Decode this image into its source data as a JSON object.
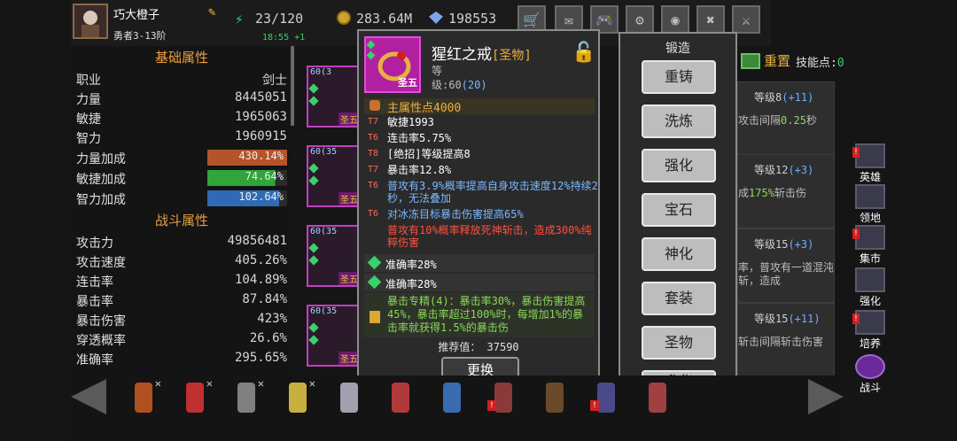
{
  "player": {
    "name": "巧大橙子",
    "rank": "勇者3-13阶",
    "energy": "23/120",
    "energy_timer": "18:55 +1",
    "gold": "283.64M",
    "gems": "198553"
  },
  "top_buttons": [
    "shop-cart-icon",
    "mail-icon",
    "gamepad-icon",
    "gear-icon",
    "palette-icon",
    "locked-icon",
    "swords-icon"
  ],
  "stats": {
    "basic_title": "基础属性",
    "battle_title": "战斗属性",
    "basic": [
      {
        "label": "职业",
        "value": "剑士"
      },
      {
        "label": "力量",
        "value": "8445051"
      },
      {
        "label": "敏捷",
        "value": "1965063"
      },
      {
        "label": "智力",
        "value": "1960915"
      }
    ],
    "bonuses": [
      {
        "label": "力量加成",
        "value": "430.14%",
        "color": "#b5542a",
        "fill": 1.0
      },
      {
        "label": "敏捷加成",
        "value": "74.64%",
        "color": "#2fa53a",
        "fill": 0.85
      },
      {
        "label": "智力加成",
        "value": "102.64%",
        "color": "#2f6ab5",
        "fill": 0.9
      }
    ],
    "battle": [
      {
        "label": "攻击力",
        "value": "49856481"
      },
      {
        "label": "攻击速度",
        "value": "405.26%"
      },
      {
        "label": "连击率",
        "value": "104.89%"
      },
      {
        "label": "暴击率",
        "value": "87.84%"
      },
      {
        "label": "暴击伤害",
        "value": "423%"
      },
      {
        "label": "穿透概率",
        "value": "26.6%"
      },
      {
        "label": "准确率",
        "value": "295.65%"
      }
    ]
  },
  "equipment_slots": [
    {
      "level": "60(3",
      "tag": "圣五"
    },
    {
      "level": "60(35",
      "tag": "圣五"
    },
    {
      "level": "60(35",
      "tag": "圣五"
    },
    {
      "level": "60(35",
      "tag": "圣五"
    }
  ],
  "item": {
    "name": "猩红之戒",
    "rarity": "[圣物]",
    "tier": "圣五",
    "level_label": "等",
    "level_prefix": "级:60",
    "level_bonus": "(20)",
    "main_attr": "主属性点4000",
    "affixes": [
      {
        "tier": "T7",
        "text": "敏捷1993",
        "color": "#ffffff"
      },
      {
        "tier": "T6",
        "text": "连击率5.75%",
        "color": "#ffffff"
      },
      {
        "tier": "T8",
        "text": "[绝招]等级提高8",
        "color": "#ffffff"
      },
      {
        "tier": "T7",
        "text": "暴击率12.8%",
        "color": "#ffffff"
      },
      {
        "tier": "T6",
        "text": "普攻有3.9%概率提高自身攻击速度12%持续2秒，无法叠加",
        "color": "#7ab8ff"
      },
      {
        "tier": "T6",
        "text": "对冰冻目标暴击伤害提高65%",
        "color": "#7ab8ff"
      },
      {
        "tier": "",
        "text": "普攻有10%概率释放死神斩击，造成300%纯粹伤害",
        "color": "#ff5040"
      }
    ],
    "gems": [
      "准确率28%",
      "准确率28%"
    ],
    "set_bonus": "暴击专精(4)：暴击率30%，暴击伤害提高45%，暴击率超过100%时，每增加1%的暴击率就获得1.5%的暴击伤",
    "recommend": "推荐值： 37590",
    "replace_label": "更换"
  },
  "forge": {
    "title": "锻造",
    "buttons": [
      "重铸",
      "洗炼",
      "强化",
      "宝石",
      "神化",
      "套装",
      "圣物",
      "升华"
    ]
  },
  "skills": {
    "reset_label": "重置",
    "points_label": "技能点:",
    "points_value": "0",
    "cards": [
      {
        "level": "等级8",
        "bonus": "(+11)",
        "desc_a": "攻击间隔",
        "desc_hl": "0.25",
        "desc_b": "秒"
      },
      {
        "level": "等级12",
        "bonus": "(+3)",
        "desc_a": "成",
        "desc_hl": "175%",
        "desc_b": "斩击伤"
      },
      {
        "level": "等级15",
        "bonus": "(+3)",
        "desc_a": "率，普攻有一道混沌斩，造成",
        "desc_hl": "",
        "desc_b": ""
      },
      {
        "level": "等级15",
        "bonus": "(+11)",
        "desc_a": "斩击间隔斩击伤害",
        "desc_hl": "",
        "desc_b": ""
      }
    ]
  },
  "nav": [
    {
      "label": "英雄",
      "icon": "hero-icon",
      "alert": true
    },
    {
      "label": "领地",
      "icon": "territory-icon",
      "alert": false
    },
    {
      "label": "集市",
      "icon": "market-icon",
      "alert": true
    },
    {
      "label": "强化",
      "icon": "enhance-icon",
      "alert": false
    },
    {
      "label": "培养",
      "icon": "train-icon",
      "alert": true
    },
    {
      "label": "战斗",
      "icon": "battle-icon",
      "alert": false
    }
  ],
  "heroes": [
    {
      "color": "#b05020",
      "crossed": true,
      "alert": false
    },
    {
      "color": "#c03030",
      "crossed": true,
      "alert": false
    },
    {
      "color": "#808080",
      "crossed": true,
      "alert": false
    },
    {
      "color": "#c8b040",
      "crossed": true,
      "alert": false
    },
    {
      "color": "#a0a0b0",
      "crossed": false,
      "alert": false
    },
    {
      "color": "#b03a3a",
      "crossed": false,
      "alert": false
    },
    {
      "color": "#3a6ab0",
      "crossed": false,
      "alert": false
    },
    {
      "color": "#8a3a3a",
      "crossed": false,
      "alert": true
    },
    {
      "color": "#6a4a2a",
      "crossed": false,
      "alert": false
    },
    {
      "color": "#4a4a8a",
      "crossed": false,
      "alert": true
    },
    {
      "color": "#a04040",
      "crossed": false,
      "alert": false
    }
  ]
}
